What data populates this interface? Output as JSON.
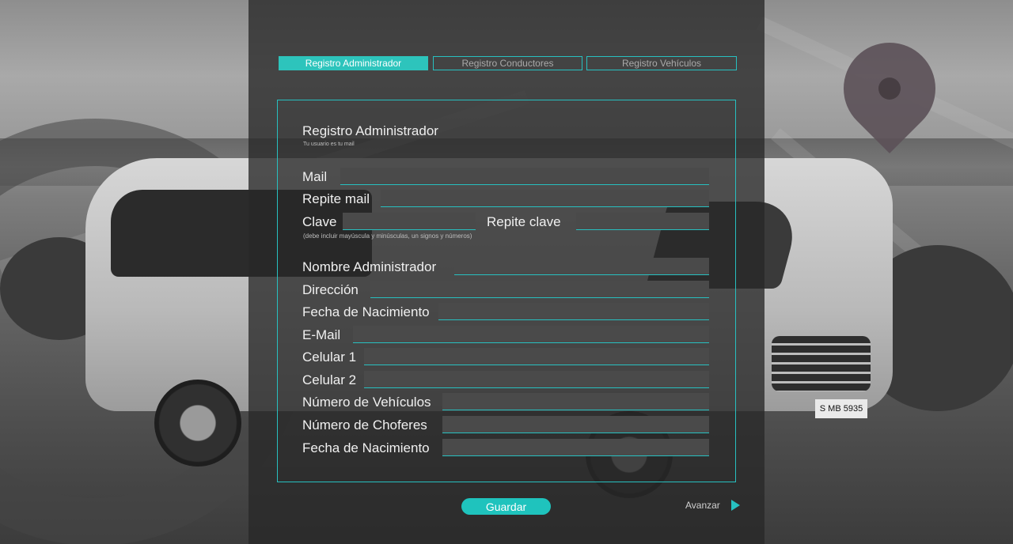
{
  "tabs": [
    {
      "label": "Registro Administrador",
      "active": true
    },
    {
      "label": "Registro Conductores",
      "active": false
    },
    {
      "label": "Registro Vehículos",
      "active": false
    }
  ],
  "form": {
    "title": "Registro Administrador",
    "subtitle": "Tu usuario es tu mail",
    "password_hint": "(debe incluir mayúscula y minúsculas, un signos y números)",
    "labels": {
      "mail": "Mail",
      "repite_mail": "Repite mail",
      "clave": "Clave",
      "repite_clave": "Repite clave",
      "nombre": "Nombre Administrador",
      "direccion": "Dirección",
      "fecha_nacimiento": "Fecha de Nacimiento",
      "email": "E-Mail",
      "celular1": "Celular 1",
      "celular2": "Celular 2",
      "num_vehiculos": "Número de Vehículos",
      "num_choferes": "Número de Choferes",
      "fecha_nacimiento2": "Fecha de Nacimiento"
    },
    "values": {
      "mail": "",
      "repite_mail": "",
      "clave": "",
      "repite_clave": "",
      "nombre": "",
      "direccion": "",
      "fecha_nacimiento": "",
      "email": "",
      "celular1": "",
      "celular2": "",
      "num_vehiculos": "",
      "num_choferes": "",
      "fecha_nacimiento2": ""
    }
  },
  "actions": {
    "save_label": "Guardar",
    "next_label": "Avanzar"
  },
  "background": {
    "plate_text": "S MB 5935"
  },
  "colors": {
    "accent": "#27c0c0",
    "button": "#1fc3bd",
    "panel": "#282828",
    "field": "#4a4a4a"
  },
  "icons": {
    "logo": "map-pin-icon",
    "next": "play-triangle-icon"
  }
}
